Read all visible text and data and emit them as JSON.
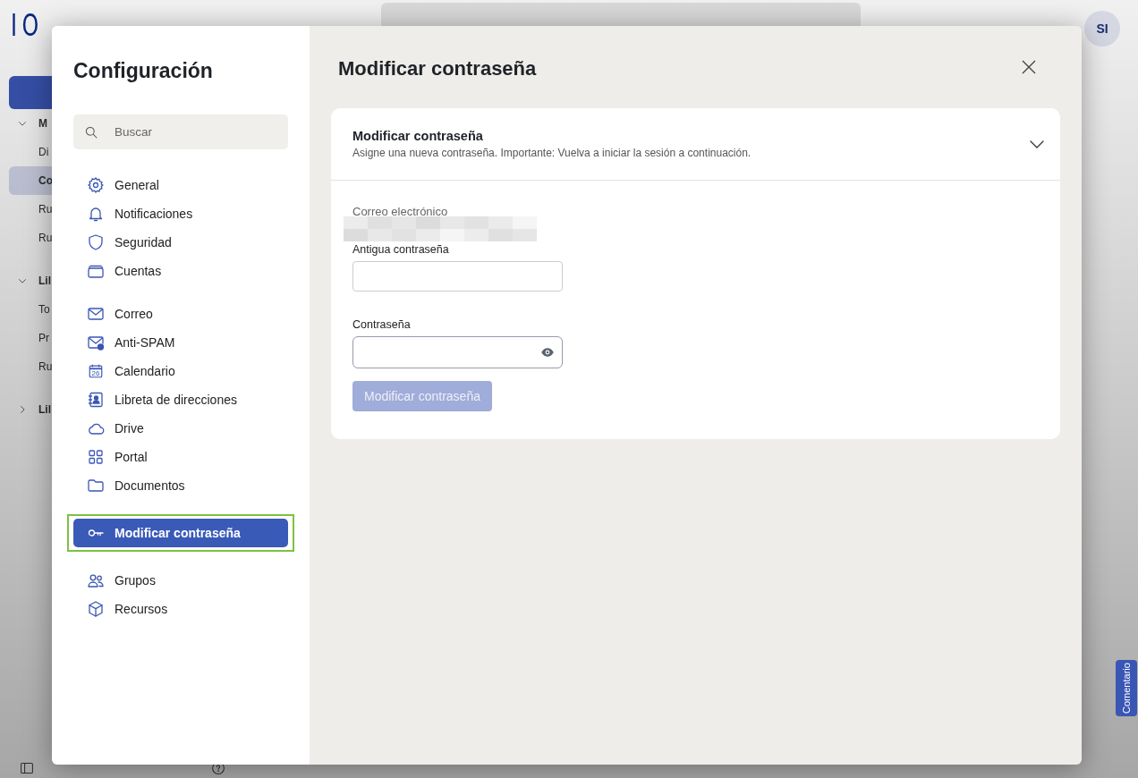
{
  "app": {
    "logo": "IO",
    "avatar": "SI",
    "sidebar": [
      {
        "label": "M",
        "kind": "header",
        "expanded": true,
        "selected": false
      },
      {
        "label": "Di",
        "kind": "item",
        "selected": false
      },
      {
        "label": "Co",
        "kind": "item",
        "selected": true
      },
      {
        "label": "Ru",
        "kind": "item",
        "selected": false
      },
      {
        "label": "Ru",
        "kind": "item",
        "selected": false
      },
      {
        "label": "Lil",
        "kind": "header",
        "expanded": true,
        "selected": false
      },
      {
        "label": "To",
        "kind": "item",
        "selected": false
      },
      {
        "label": "Pr",
        "kind": "item",
        "selected": false
      },
      {
        "label": "Ru",
        "kind": "item",
        "selected": false
      },
      {
        "label": "Lil",
        "kind": "header",
        "expanded": false,
        "selected": false
      }
    ],
    "feedback_tab": "Comentario"
  },
  "dialog": {
    "title": "Configuración",
    "search": {
      "placeholder": "Buscar"
    },
    "groups": [
      {
        "items": [
          {
            "label": "General",
            "selected": false
          },
          {
            "label": "Notificaciones",
            "selected": false
          },
          {
            "label": "Seguridad",
            "selected": false
          },
          {
            "label": "Cuentas",
            "selected": false
          }
        ]
      },
      {
        "items": [
          {
            "label": "Correo",
            "selected": false
          },
          {
            "label": "Anti-SPAM",
            "selected": false
          },
          {
            "label": "Calendario",
            "selected": false,
            "icon_text": "26"
          },
          {
            "label": "Libreta de direcciones",
            "selected": false
          },
          {
            "label": "Drive",
            "selected": false
          },
          {
            "label": "Portal",
            "selected": false
          },
          {
            "label": "Documentos",
            "selected": false
          }
        ]
      },
      {
        "items": [
          {
            "label": "Modificar contraseña",
            "selected": true,
            "highlighted": true
          }
        ]
      },
      {
        "items": [
          {
            "label": "Grupos",
            "selected": false
          },
          {
            "label": "Recursos",
            "selected": false
          }
        ]
      }
    ],
    "page_title": "Modificar contraseña",
    "section": {
      "title": "Modificar contraseña",
      "description": "Asigne una nueva contraseña. Importante: Vuelva a iniciar la sesión a continuación.",
      "expanded": true,
      "email_label": "Correo electrónico",
      "fields": [
        {
          "label": "Antigua contraseña",
          "reveal": false
        },
        {
          "label": "Contraseña",
          "reveal": true
        }
      ],
      "submit": {
        "label": "Modificar contraseña",
        "disabled": true
      }
    }
  }
}
